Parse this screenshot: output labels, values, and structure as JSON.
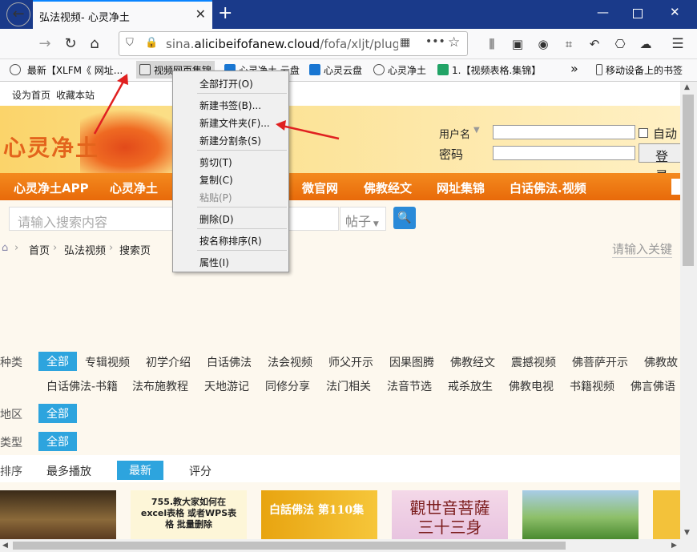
{
  "tab": {
    "title": "弘法视频- 心灵净土"
  },
  "url": {
    "prefix": "sina.",
    "domain": "alicibeifofanew.cloud",
    "path": "/fofa/xljt/plugin.p"
  },
  "bookmarks": [
    {
      "label": "最新【XLFM《 网址..."
    },
    {
      "label": "视频网页集锦"
    },
    {
      "label": "心灵净土 云盘"
    },
    {
      "label": "心灵云盘"
    },
    {
      "label": "心灵净土"
    },
    {
      "label": "1.【视频表格.集锦】"
    },
    {
      "label": "»"
    },
    {
      "label": "移动设备上的书签"
    }
  ],
  "page": {
    "top_links": [
      "设为首页",
      "收藏本站"
    ],
    "logo": "心灵净土",
    "login": {
      "user_label": "用户名",
      "pass_label": "密码",
      "auto": "自动",
      "login_btn": "登录"
    },
    "menu": [
      "心灵净土APP",
      "心灵净土",
      "微官网",
      "佛教经文",
      "网址集锦",
      "白话佛法.视频"
    ],
    "search_placeholder": "请输入搜索内容",
    "search_select": "帖子",
    "crumbs": [
      "首页",
      "弘法视频",
      "搜索页"
    ],
    "kw_placeholder": "请输入关键",
    "filters": {
      "category_label": "种类",
      "region_label": "地区",
      "type_label": "类型",
      "sort_label": "排序",
      "all": "全部",
      "categories_row1": [
        "专辑视频",
        "初学介绍",
        "白话佛法",
        "法会视频",
        "师父开示",
        "因果图腾",
        "佛教经文",
        "震撼视频",
        "佛菩萨开示",
        "佛教故"
      ],
      "categories_row2": [
        "白话佛法-书籍",
        "法布施教程",
        "天地游记",
        "同修分享",
        "法门相关",
        "法音节选",
        "戒杀放生",
        "佛教电视",
        "书籍视频",
        "佛言佛语"
      ],
      "sort": [
        "最多播放",
        "最新",
        "评分"
      ]
    },
    "thumbs": [
      {
        "text": ""
      },
      {
        "text": "755.教大家如何在 excel表格 或者WPS表格 批量删除"
      },
      {
        "text": "白話佛法 第110集"
      },
      {
        "text": "觀世音菩薩 三十三身"
      },
      {
        "text": ""
      }
    ]
  },
  "context_menu": {
    "items": [
      "全部打开(O)",
      "新建书签(B)...",
      "新建文件夹(F)...",
      "新建分割条(S)",
      "剪切(T)",
      "复制(C)",
      "粘贴(P)",
      "删除(D)",
      "按名称排序(R)",
      "属性(I)"
    ]
  },
  "colors": {
    "accent": "#2da4de",
    "menu": "#f07a14",
    "tabbar": "#1a3a8a",
    "arrow": "#e02020"
  }
}
